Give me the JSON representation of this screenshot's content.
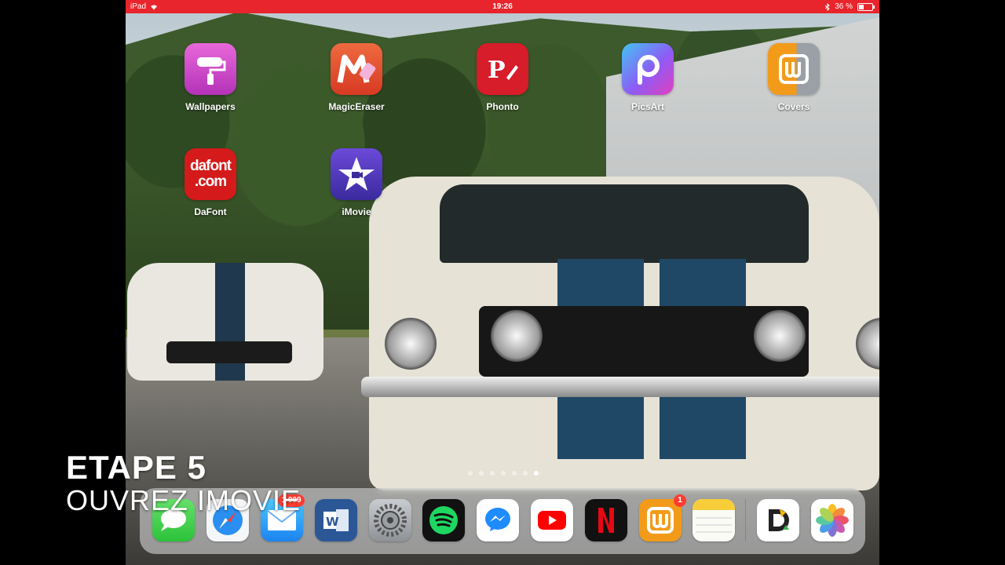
{
  "status_bar": {
    "device": "iPad",
    "time": "19:26",
    "battery": "36 %"
  },
  "home": {
    "apps": [
      {
        "label": "Wallpapers"
      },
      {
        "label": "MagicEraser"
      },
      {
        "label": "Phonto"
      },
      {
        "label": "PicsArt"
      },
      {
        "label": "Covers"
      },
      {
        "label": "DaFont"
      },
      {
        "label": "iMovie"
      }
    ],
    "dafont_icon_text": [
      "dafont",
      ".com"
    ],
    "page_count": 7,
    "active_page": 7
  },
  "dock": {
    "apps": [
      "messages-icon",
      "safari-icon",
      "mail-icon",
      "word-icon",
      "settings-icon",
      "spotify-icon",
      "messenger-icon",
      "youtube-icon",
      "netflix-icon",
      "wattpad-icon",
      "notes-icon",
      "dictionary-icon",
      "photos-icon"
    ],
    "badges": {
      "wattpad": "1",
      "mail": "1 009"
    }
  },
  "caption": {
    "step": "ETAPE 5",
    "sub": "OUVREZ IMOVIE"
  },
  "colors": {
    "status_bar": "#e8252c"
  }
}
